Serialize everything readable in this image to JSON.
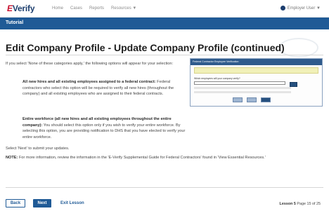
{
  "nav": {
    "logo_prefix": "E",
    "logo_text": "Verify",
    "links": [
      "Home",
      "Cases",
      "Reports",
      "Resources ▼"
    ],
    "user": "Employer User ▼"
  },
  "tutorial_bar": {
    "label": "Tutorial"
  },
  "page": {
    "title": "Edit Company Profile - Update Company Profile (continued)",
    "intro": "If you select 'None of these categories apply,' the following options will appear for your selection:",
    "option1_heading": "All new hires and all existing employees assigned to a federal contract:",
    "option1_body": " Federal contractors who select this option will be required to verify all new hires (throughout the company) and all existing employees who are assigned to their federal contracts.",
    "option2_heading": "Entire workforce (all new hires and all existing employees throughout the entire company):",
    "option2_body": " You should select this option only if you wish to verify your entire workforce. By selecting this option, you are providing notification to DHS that you have elected to verify your entire workforce.",
    "select_next": "Select 'Next' to submit your updates.",
    "note_label": "NOTE:",
    "note_body": " For more information, review the information in the 'E-Verify Supplemental Guide for Federal Contractors' found in 'View Essential Resources.'"
  },
  "screenshot": {
    "header": "Federal Contractor Employee Verification",
    "question": "Which employees will your company verify?"
  },
  "footer": {
    "back_label": "Back",
    "next_label": "Next",
    "exit_label": "Exit Lesson",
    "lesson_label": "Lesson 5",
    "page_label": "Page 15 of 25"
  },
  "colors": {
    "brand_blue": "#1f5a96",
    "nav_text": "#8b8b8b",
    "logo_red": "#c8102e"
  },
  "icons": [
    "user-icon",
    "dropdown-chevron-icon"
  ]
}
